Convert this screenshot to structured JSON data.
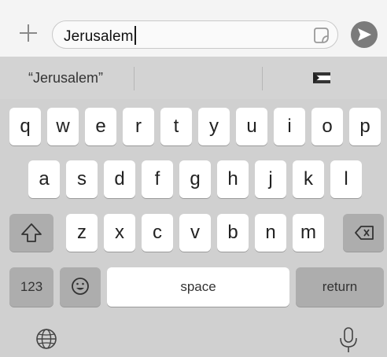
{
  "compose": {
    "message_text": "Jerusalem"
  },
  "suggestions": {
    "left": "“Jerusalem”",
    "middle": "",
    "right_icon": "flag-emoji-icon"
  },
  "keyboard": {
    "row1": [
      "q",
      "w",
      "e",
      "r",
      "t",
      "y",
      "u",
      "i",
      "o",
      "p"
    ],
    "row2": [
      "a",
      "s",
      "d",
      "f",
      "g",
      "h",
      "j",
      "k",
      "l"
    ],
    "row3": [
      "z",
      "x",
      "c",
      "v",
      "b",
      "n",
      "m"
    ],
    "numbers_label": "123",
    "space_label": "space",
    "return_label": "return"
  },
  "icons": {
    "plus": "plus-icon",
    "sticker": "sticker-icon",
    "send": "send-arrow-icon",
    "shift": "shift-icon",
    "backspace": "backspace-icon",
    "emoji": "emoji-icon",
    "globe": "globe-icon",
    "microphone": "microphone-icon"
  },
  "colors": {
    "key_background": "#ffffff",
    "function_key_background": "#adadad",
    "keyboard_background": "#d0d0d0",
    "send_button": "#7b7b7b"
  }
}
